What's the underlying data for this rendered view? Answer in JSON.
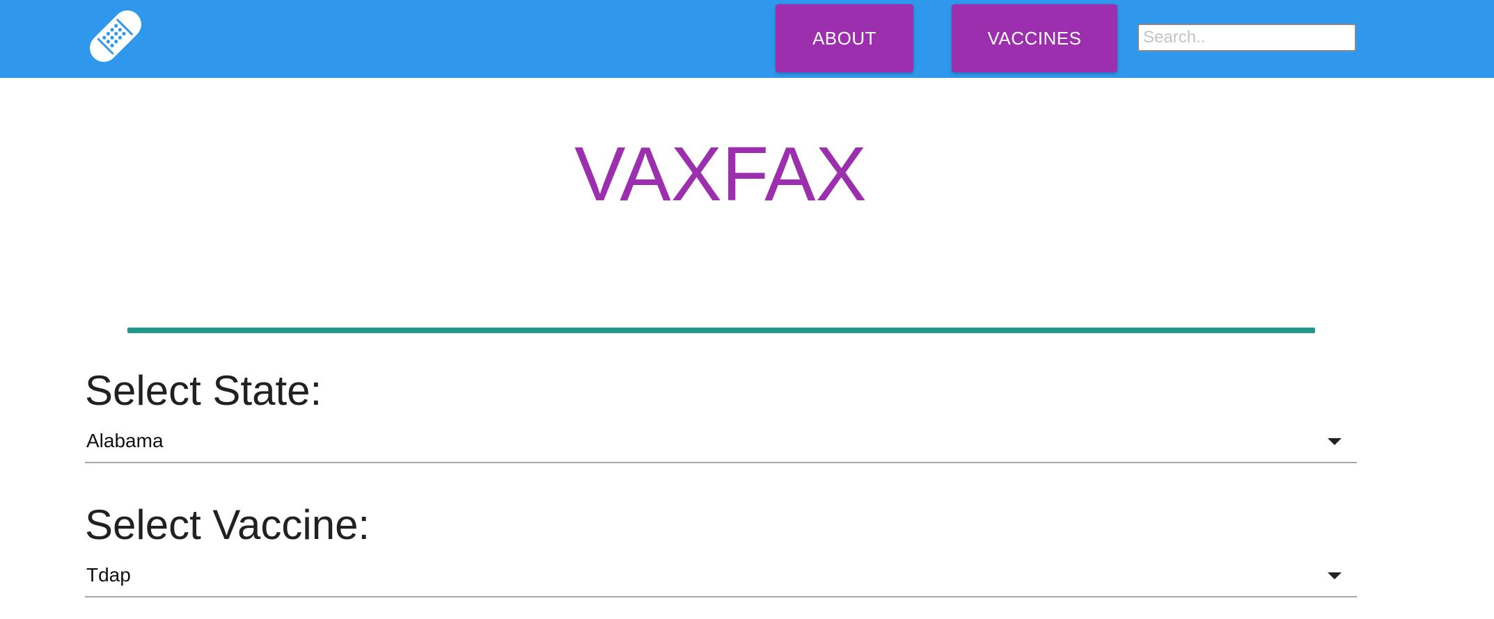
{
  "header": {
    "logo_icon": "bandage-icon",
    "nav": {
      "about_label": "ABOUT",
      "vaccines_label": "VACCINES"
    },
    "search": {
      "placeholder": "Search..",
      "value": ""
    }
  },
  "main": {
    "title": "VAXFAX",
    "state_select": {
      "label": "Select State:",
      "value": "Alabama"
    },
    "vaccine_select": {
      "label": "Select Vaccine:",
      "value": "Tdap"
    }
  },
  "colors": {
    "header_bg": "#2f98ec",
    "accent_purple": "#9c2fae",
    "divider_teal": "#20988a"
  }
}
